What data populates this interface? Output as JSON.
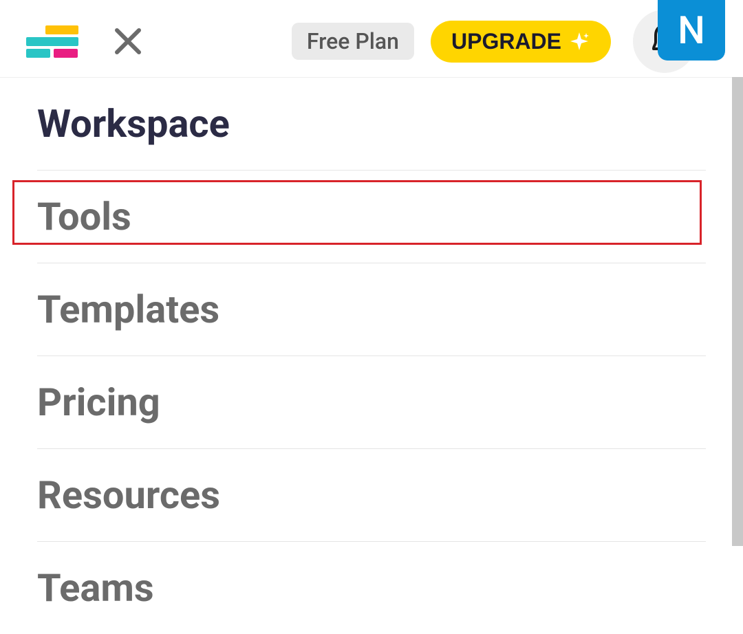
{
  "header": {
    "plan_label": "Free Plan",
    "upgrade_label": "UPGRADE",
    "avatar_initial": "N"
  },
  "menu": {
    "items": [
      {
        "label": "Workspace",
        "active": true
      },
      {
        "label": "Tools",
        "active": false,
        "highlighted": true
      },
      {
        "label": "Templates",
        "active": false
      },
      {
        "label": "Pricing",
        "active": false
      },
      {
        "label": "Resources",
        "active": false
      },
      {
        "label": "Teams",
        "active": false
      }
    ]
  },
  "colors": {
    "accent_yellow": "#FFD500",
    "avatar_blue": "#0B8FD6",
    "highlight_red": "#D8232A"
  }
}
